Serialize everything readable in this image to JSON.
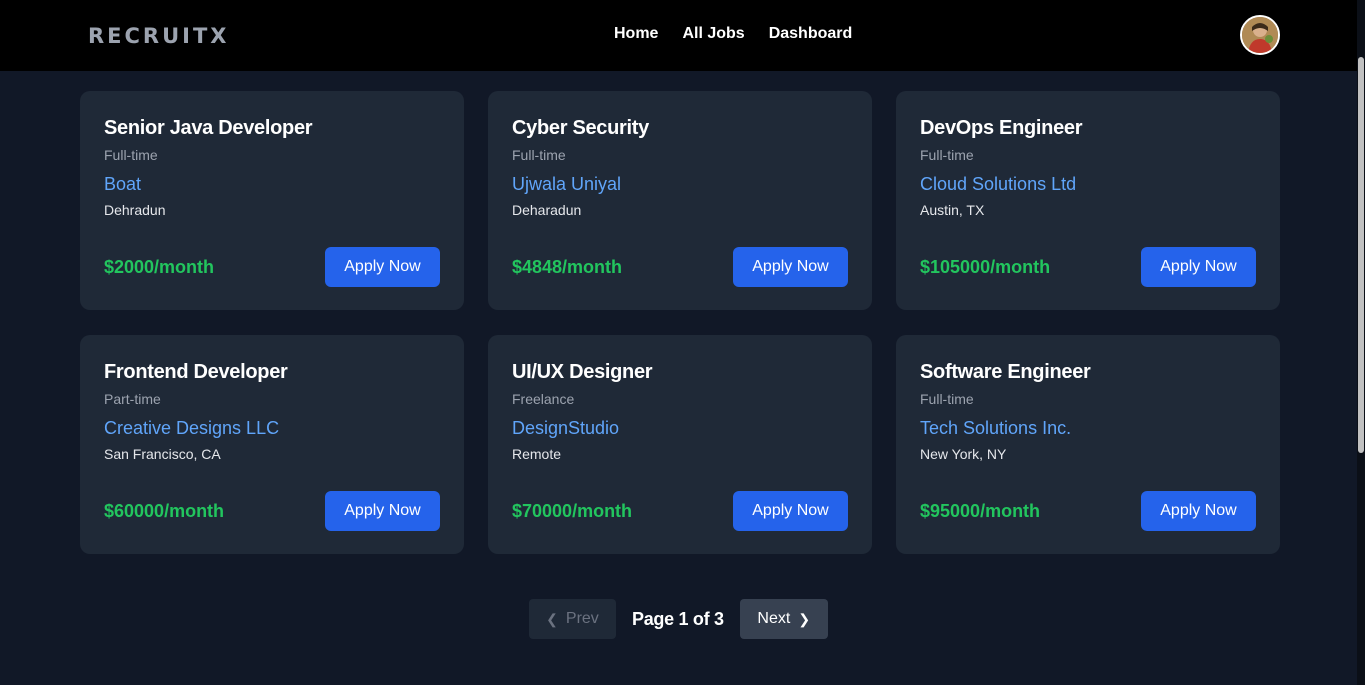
{
  "brand": {
    "logo_text": "RECRUITX"
  },
  "nav": {
    "items": [
      "Home",
      "All Jobs",
      "Dashboard"
    ]
  },
  "jobs": [
    {
      "title": "Senior Java Developer",
      "type": "Full-time",
      "company": "Boat",
      "location": "Dehradun",
      "salary": "$2000/month",
      "apply_label": "Apply Now"
    },
    {
      "title": "Cyber Security",
      "type": "Full-time",
      "company": "Ujwala Uniyal",
      "location": "Deharadun",
      "salary": "$4848/month",
      "apply_label": "Apply Now"
    },
    {
      "title": "DevOps Engineer",
      "type": "Full-time",
      "company": "Cloud Solutions Ltd",
      "location": "Austin, TX",
      "salary": "$105000/month",
      "apply_label": "Apply Now"
    },
    {
      "title": "Frontend Developer",
      "type": "Part-time",
      "company": "Creative Designs LLC",
      "location": "San Francisco, CA",
      "salary": "$60000/month",
      "apply_label": "Apply Now"
    },
    {
      "title": "UI/UX Designer",
      "type": "Freelance",
      "company": "DesignStudio",
      "location": "Remote",
      "salary": "$70000/month",
      "apply_label": "Apply Now"
    },
    {
      "title": "Software Engineer",
      "type": "Full-time",
      "company": "Tech Solutions Inc.",
      "location": "New York, NY",
      "salary": "$95000/month",
      "apply_label": "Apply Now"
    }
  ],
  "pagination": {
    "prev_label": "Prev",
    "next_label": "Next",
    "page_text": "Page 1 of 3"
  },
  "colors": {
    "accent": "#2563eb",
    "salary": "#22c55e",
    "company_link": "#60a5fa",
    "card_bg": "#1f2937",
    "page_bg": "#111827"
  },
  "icons": {
    "prev": "chevron-left-icon",
    "next": "chevron-right-icon",
    "avatar": "user-avatar"
  }
}
